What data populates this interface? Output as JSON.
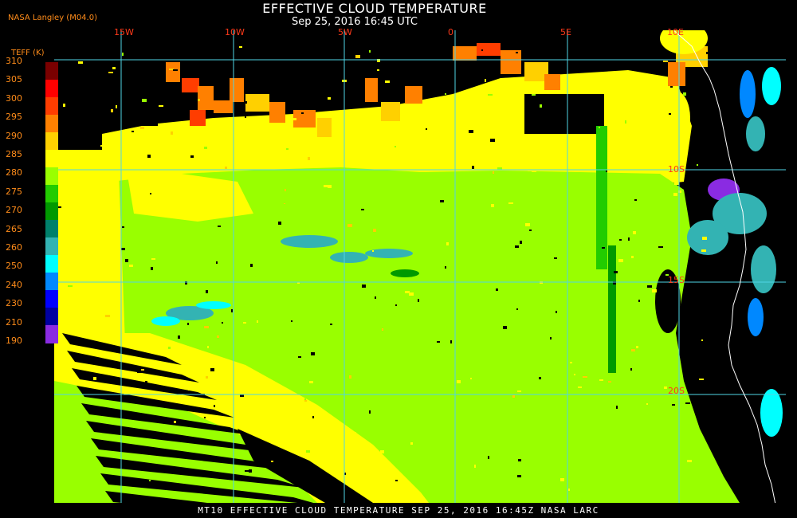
{
  "header": {
    "title": "EFFECTIVE CLOUD TEMPERATURE",
    "subtitle": "Sep 25, 2016 16:45 UTC",
    "producer": "NASA Langley (M04.0)"
  },
  "legend": {
    "title": "TEFF (K)",
    "ticks": [
      "310",
      "305",
      "300",
      "295",
      "290",
      "285",
      "280",
      "275",
      "270",
      "265",
      "260",
      "250",
      "240",
      "230",
      "210",
      "190"
    ],
    "colors": [
      "#7a0000",
      "#ff0000",
      "#ff3d00",
      "#ff8000",
      "#ffd000",
      "#ffff00",
      "#99ff00",
      "#22cc00",
      "#009900",
      "#00806b",
      "#33b3b3",
      "#00ffff",
      "#0088ff",
      "#0000ff",
      "#0000a0",
      "#8a2be2"
    ]
  },
  "grid": {
    "longitude_labels": [
      "15W",
      "10W",
      "5W",
      "0",
      "5E",
      "10E"
    ],
    "latitude_labels": [
      "10S",
      "15S",
      "20S"
    ]
  },
  "footer": {
    "caption": "MT10  EFFECTIVE CLOUD TEMPERATURE   SEP 25, 2016 16:45Z   NASA LARC"
  },
  "colors": {
    "gridline": "#4fd6e6",
    "label": "#ff3a1a",
    "legend_text": "#ff8c1a",
    "coastline": "#ffffff"
  }
}
